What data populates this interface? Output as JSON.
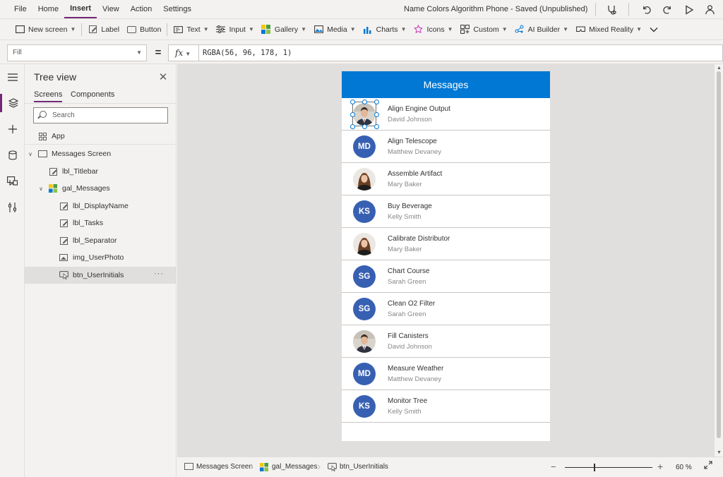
{
  "menu": {
    "items": [
      "File",
      "Home",
      "Insert",
      "View",
      "Action",
      "Settings"
    ],
    "active_index": 2,
    "doc_title": "Name Colors Algorithm Phone - Saved (Unpublished)"
  },
  "ribbon": {
    "new_screen": "New screen",
    "label": "Label",
    "button": "Button",
    "text": "Text",
    "input": "Input",
    "gallery": "Gallery",
    "media": "Media",
    "charts": "Charts",
    "icons": "Icons",
    "custom": "Custom",
    "ai_builder": "AI Builder",
    "mixed_reality": "Mixed Reality"
  },
  "formula": {
    "property": "Fill",
    "equals": "=",
    "fx": "fx",
    "value": "RGBA(56, 96, 178, 1)"
  },
  "tree": {
    "title": "Tree view",
    "tabs": [
      "Screens",
      "Components"
    ],
    "search_placeholder": "Search",
    "app": "App",
    "screen": "Messages Screen",
    "items": [
      "lbl_Titlebar",
      "gal_Messages",
      "lbl_DisplayName",
      "lbl_Tasks",
      "lbl_Separator",
      "img_UserPhoto",
      "btn_UserInitials"
    ],
    "more": "···"
  },
  "phone": {
    "title": "Messages",
    "rows": [
      {
        "task": "Align Engine Output",
        "person": "David Johnson",
        "type": "photo",
        "photo": "man"
      },
      {
        "task": "Align Telescope",
        "person": "Matthew Devaney",
        "type": "initials",
        "initials": "MD"
      },
      {
        "task": "Assemble Artifact",
        "person": "Mary Baker",
        "type": "photo",
        "photo": "woman"
      },
      {
        "task": "Buy Beverage",
        "person": "Kelly Smith",
        "type": "initials",
        "initials": "KS"
      },
      {
        "task": "Calibrate Distributor",
        "person": "Mary Baker",
        "type": "photo",
        "photo": "woman"
      },
      {
        "task": "Chart Course",
        "person": "Sarah Green",
        "type": "initials",
        "initials": "SG"
      },
      {
        "task": "Clean O2 Filter",
        "person": "Sarah Green",
        "type": "initials",
        "initials": "SG"
      },
      {
        "task": "Fill Canisters",
        "person": "David Johnson",
        "type": "photo",
        "photo": "man"
      },
      {
        "task": "Measure Weather",
        "person": "Matthew Devaney",
        "type": "initials",
        "initials": "MD"
      },
      {
        "task": "Monitor Tree",
        "person": "Kelly Smith",
        "type": "initials",
        "initials": "KS"
      }
    ],
    "initials_color": "#3860b2",
    "title_color": "#0078d4"
  },
  "status": {
    "crumbs": [
      "Messages Screen",
      "gal_Messages",
      "btn_UserInitials"
    ],
    "zoom_minus": "−",
    "zoom_plus": "+",
    "zoom": "60  %",
    "zoom_level": 0.33
  },
  "colors": {
    "accent": "#742774"
  }
}
